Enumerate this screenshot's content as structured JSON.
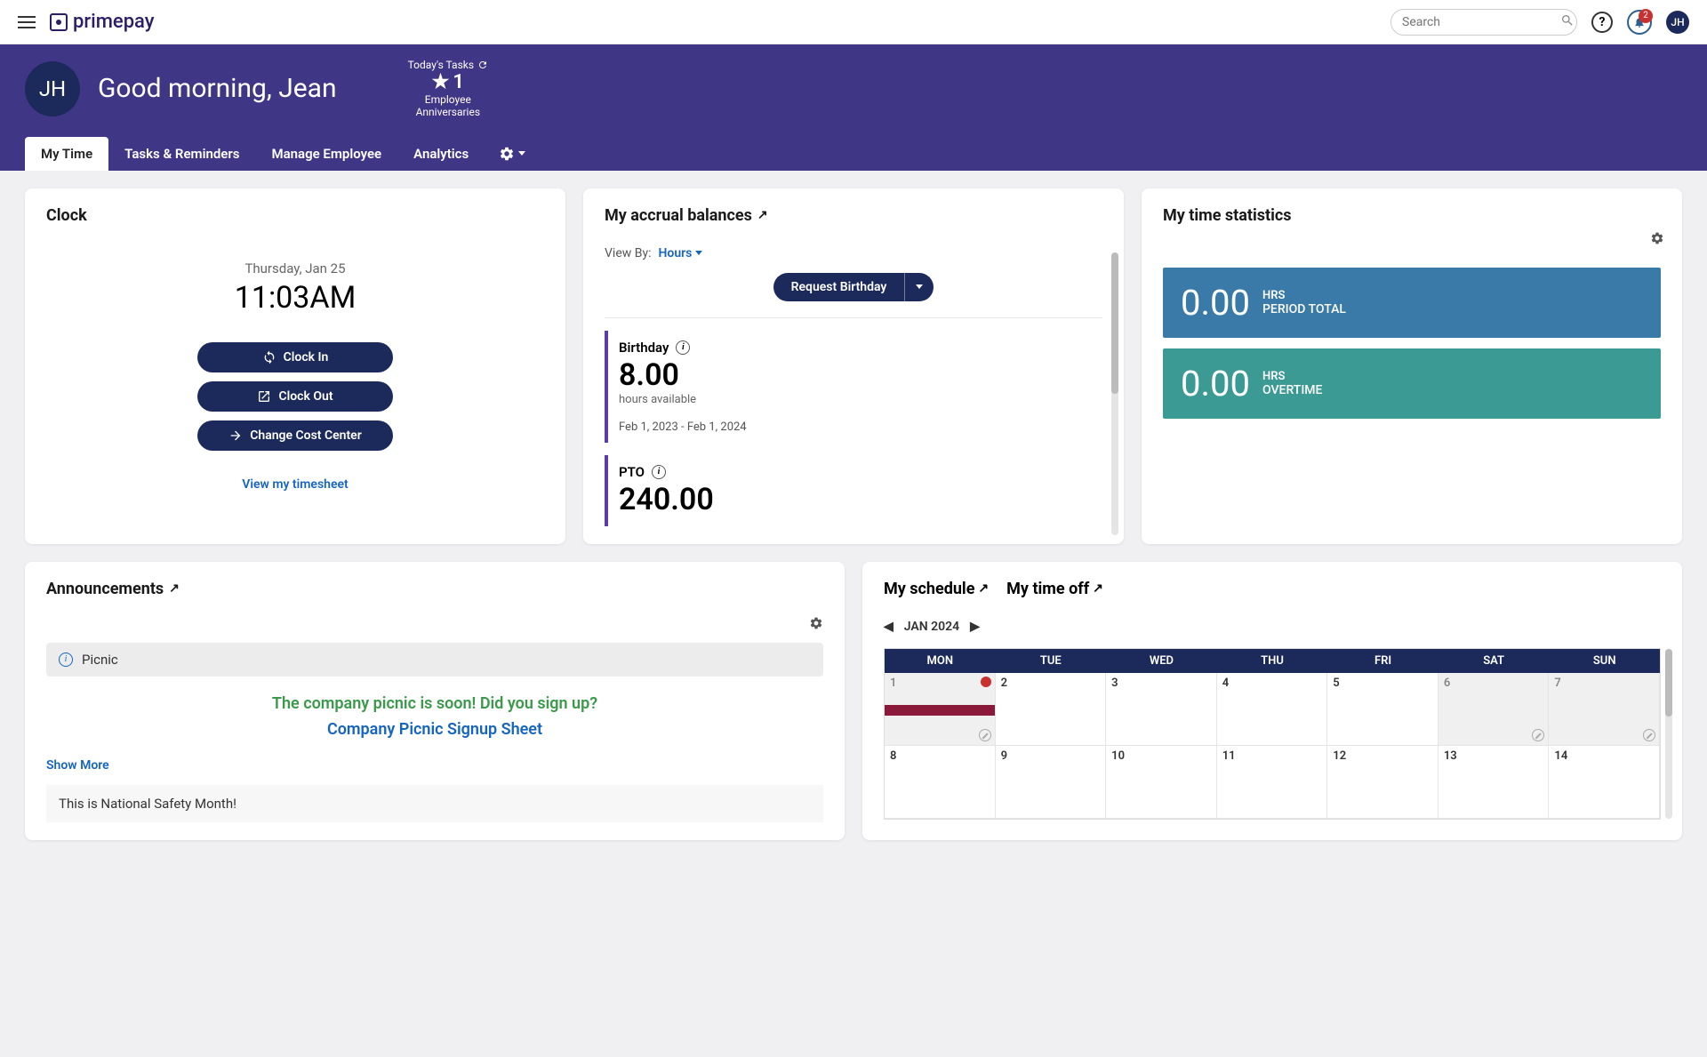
{
  "brand": "primepay",
  "search": {
    "placeholder": "Search"
  },
  "notification_count": "2",
  "avatar_initials": "JH",
  "hero": {
    "initials": "JH",
    "greeting": "Good morning, Jean",
    "tasks_label": "Today's Tasks",
    "tasks_count": "1",
    "tasks_sub1": "Employee",
    "tasks_sub2": "Anniversaries"
  },
  "tabs": [
    "My Time",
    "Tasks & Reminders",
    "Manage Employee",
    "Analytics"
  ],
  "clock": {
    "title": "Clock",
    "date": "Thursday, Jan 25",
    "time": "11:03AM",
    "btn_in": "Clock In",
    "btn_out": "Clock Out",
    "btn_cost": "Change Cost Center",
    "link": "View my timesheet"
  },
  "accrual": {
    "title": "My accrual balances",
    "viewby_label": "View By:",
    "viewby_value": "Hours",
    "request_btn": "Request Birthday",
    "items": [
      {
        "name": "Birthday",
        "value": "8.00",
        "sub": "hours available",
        "range": "Feb 1, 2023 - Feb 1, 2024"
      },
      {
        "name": "PTO",
        "value": "240.00"
      }
    ]
  },
  "stats": {
    "title": "My time statistics",
    "blocks": [
      {
        "value": "0.00",
        "unit": "HRS",
        "desc": "PERIOD TOTAL"
      },
      {
        "value": "0.00",
        "unit": "HRS",
        "desc": "OVERTIME"
      }
    ]
  },
  "announcements": {
    "title": "Announcements",
    "item1_title": "Picnic",
    "item1_text": "The company picnic is soon!  Did you sign up?",
    "item1_link": "Company Picnic Signup Sheet",
    "show_more": "Show More",
    "item2_text": "This is National Safety Month!"
  },
  "schedule": {
    "tab1": "My schedule",
    "tab2": "My time off",
    "month": "JAN 2024",
    "days": [
      "MON",
      "TUE",
      "WED",
      "THU",
      "FRI",
      "SAT",
      "SUN"
    ],
    "row1": [
      "1",
      "2",
      "3",
      "4",
      "5",
      "6",
      "7"
    ],
    "row2": [
      "8",
      "9",
      "10",
      "11",
      "12",
      "13",
      "14"
    ]
  }
}
